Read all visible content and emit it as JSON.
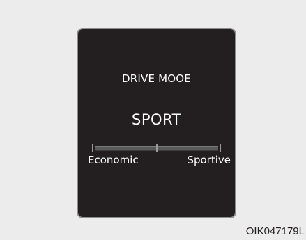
{
  "display": {
    "title": "DRIVE MOOE",
    "mode": "SPORT",
    "gauge": {
      "left_label": "Economic",
      "right_label": "Sportive"
    }
  },
  "image_code": "OIK047179L",
  "colors": {
    "background": "#ececec",
    "screen": "#231f20",
    "screen_border": "#8d8d8d",
    "text": "#ffffff",
    "gauge_bar": "#5a5a5a"
  }
}
